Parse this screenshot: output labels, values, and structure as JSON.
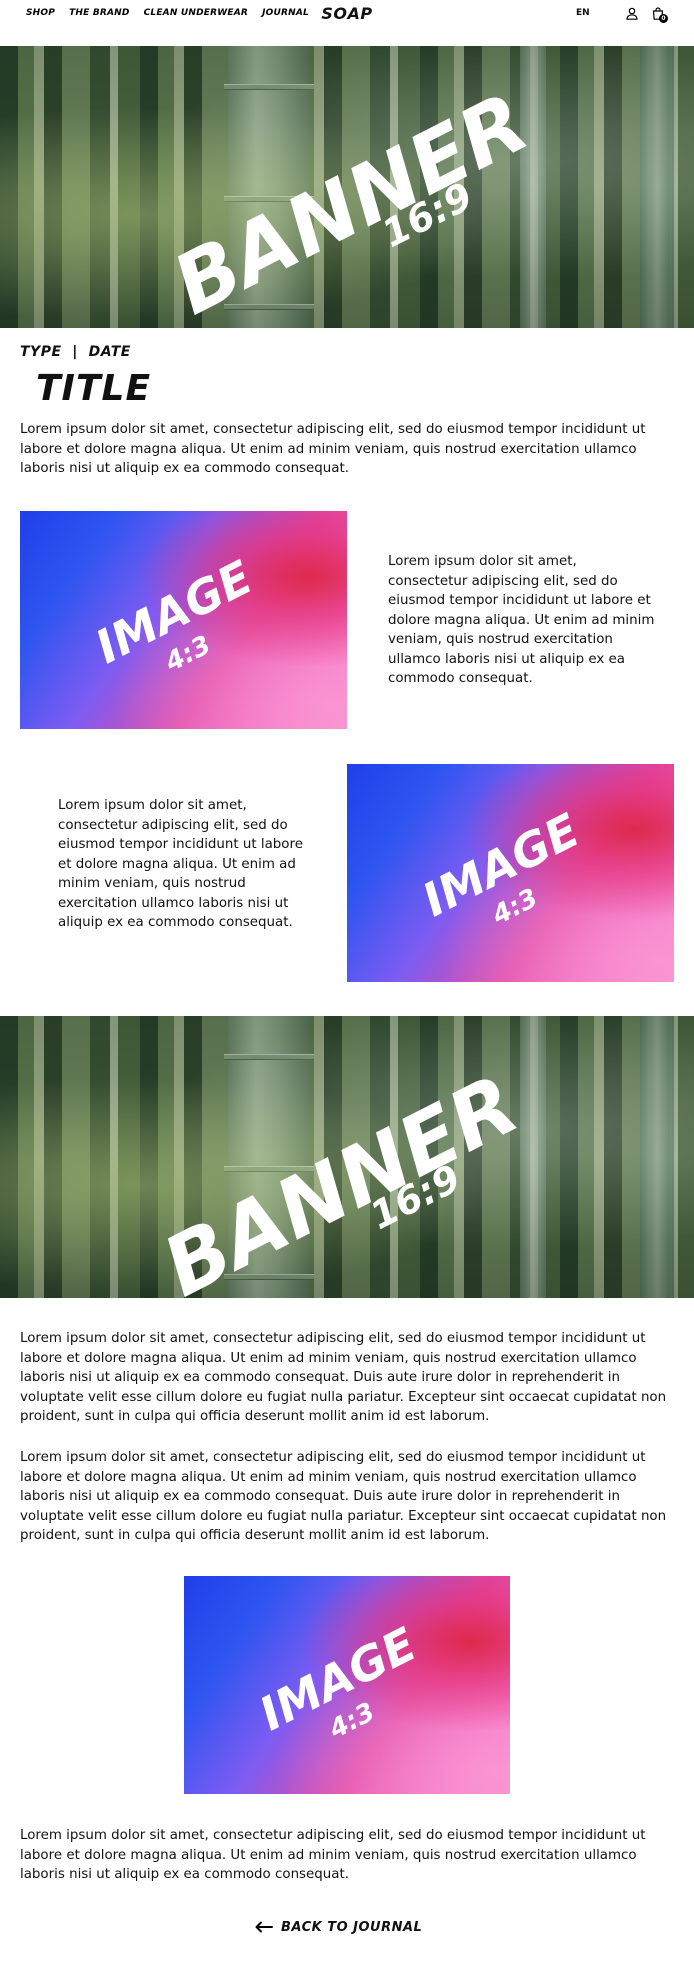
{
  "header": {
    "nav": [
      "SHOP",
      "THE BRAND",
      "CLEAN UNDERWEAR",
      "JOURNAL"
    ],
    "logo": "SOAP",
    "language": "EN",
    "account_icon": "user-icon",
    "bag_icon": "shopping-bag-icon",
    "bag_count": "0"
  },
  "banner_top": {
    "label": "BANNER",
    "ratio": "16:9"
  },
  "article": {
    "meta": "TYPE  |  DATE",
    "title": "TITLE",
    "intro": "Lorem ipsum dolor sit amet, consectetur adipiscing elit, sed do eiusmod tempor incididunt ut labore et dolore magna aliqua. Ut enim ad minim veniam, quis nostrud exercitation ullamco laboris nisi ut aliquip ex ea commodo consequat."
  },
  "row1": {
    "image_label": "IMAGE",
    "image_ratio": "4:3",
    "text": "Lorem ipsum dolor sit amet, consectetur adipiscing elit, sed do eiusmod tempor incididunt ut labore et dolore magna aliqua. Ut enim ad minim veniam, quis nostrud exercitation ullamco laboris nisi ut aliquip ex ea commodo consequat."
  },
  "row2": {
    "image_label": "IMAGE",
    "image_ratio": "4:3",
    "text": "Lorem ipsum dolor sit amet, consectetur adipiscing elit, sed do eiusmod tempor incididunt ut labore et dolore magna aliqua. Ut enim ad minim veniam, quis nostrud exercitation ullamco laboris nisi ut aliquip ex ea commodo consequat."
  },
  "banner_mid": {
    "label": "BANNER",
    "ratio": "16:9"
  },
  "body": {
    "para1": "Lorem ipsum dolor sit amet, consectetur adipiscing elit, sed do eiusmod tempor incididunt ut labore et dolore magna aliqua. Ut enim ad minim veniam, quis nostrud exercitation ullamco laboris nisi ut aliquip ex ea commodo consequat. Duis aute irure dolor in reprehenderit in voluptate velit esse cillum dolore eu fugiat nulla pariatur. Excepteur sint occaecat cupidatat non proident, sunt in culpa qui officia deserunt mollit anim id est laborum.",
    "para2": "Lorem ipsum dolor sit amet, consectetur adipiscing elit, sed do eiusmod tempor incididunt ut labore et dolore magna aliqua. Ut enim ad minim veniam, quis nostrud exercitation ullamco laboris nisi ut aliquip ex ea commodo consequat. Duis aute irure dolor in reprehenderit in voluptate velit esse cillum dolore eu fugiat nulla pariatur. Excepteur sint occaecat cupidatat non proident, sunt in culpa qui officia deserunt mollit anim id est laborum."
  },
  "center_image": {
    "label": "IMAGE",
    "ratio": "4:3"
  },
  "closing": {
    "text": "Lorem ipsum dolor sit amet, consectetur adipiscing elit, sed do eiusmod tempor incididunt ut labore et dolore magna aliqua. Ut enim ad minim veniam, quis nostrud exercitation ullamco laboris nisi ut aliquip ex ea commodo consequat."
  },
  "back_link": {
    "icon": "arrow-left-icon",
    "label": "BACK TO JOURNAL"
  }
}
